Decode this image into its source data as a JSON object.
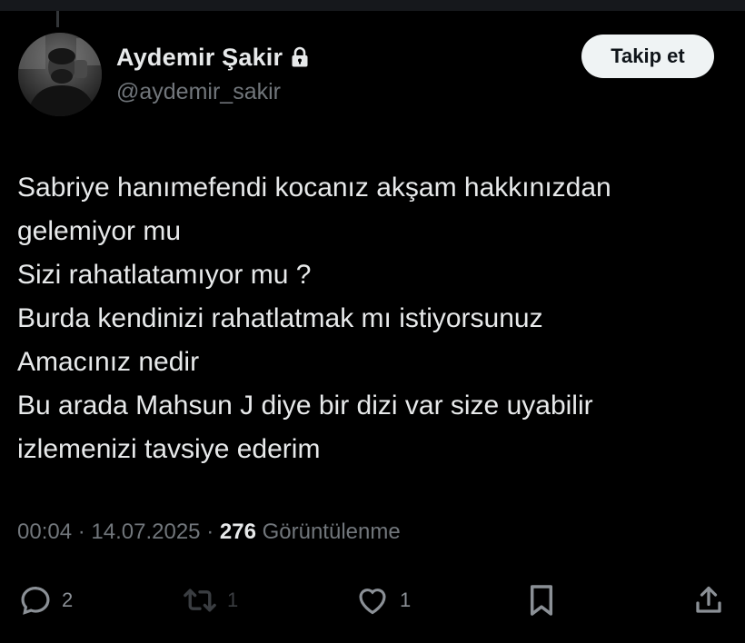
{
  "tweet": {
    "author": {
      "display_name": "Aydemir Şakir",
      "handle": "@aydemir_sakir",
      "protected_icon": "lock-icon"
    },
    "follow_label": "Takip et",
    "text_lines": [
      "Sabriye hanımefendi kocanız akşam hakkınızdan",
      "gelemiyor mu",
      "Sizi rahatlatamıyor mu ?",
      "Burda kendinizi rahatlatmak mı istiyorsunuz",
      "Amacınız nedir",
      "Bu arada Mahsun J diye bir dizi var size uyabilir",
      "izlemenizi tavsiye ederim"
    ],
    "meta": {
      "time": "00:04",
      "separator": "·",
      "date": "14.07.2025",
      "views_count": "276",
      "views_label": "Görüntülenme"
    },
    "actions": {
      "replies": "2",
      "retweets": "1",
      "likes": "1"
    }
  },
  "colors": {
    "background": "#000000",
    "text_primary": "#e7e9ea",
    "text_secondary": "#71767b",
    "follow_button_bg": "#eff3f4"
  }
}
